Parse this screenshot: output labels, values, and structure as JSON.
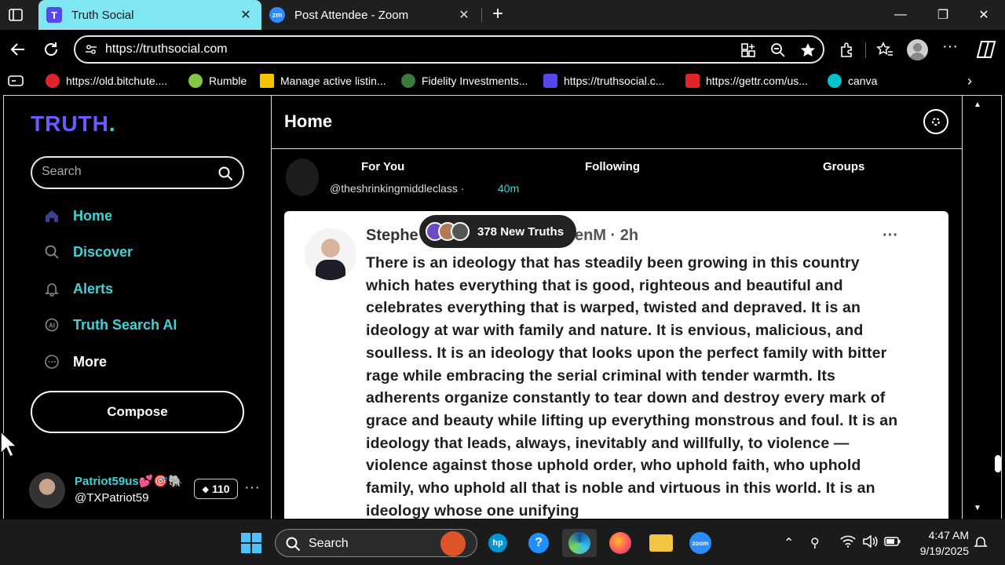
{
  "browser": {
    "tabs": [
      {
        "favicon": "T",
        "title": "Truth Social",
        "active": true
      },
      {
        "favicon": "zm",
        "title": "Post Attendee - Zoom",
        "active": false
      }
    ],
    "url": "https://truthsocial.com",
    "bookmarks": [
      {
        "label": "https://old.bitchute....",
        "icon_color": "#e0242a"
      },
      {
        "label": "Rumble",
        "icon_color": "#85c742"
      },
      {
        "label": "Manage active listin...",
        "icon_color": "#f4c400"
      },
      {
        "label": "Fidelity Investments...",
        "icon_color": "#3a7a3a"
      },
      {
        "label": "https://truthsocial.c...",
        "icon_color": "#5448ee"
      },
      {
        "label": "https://gettr.com/us...",
        "icon_color": "#e0242a"
      },
      {
        "label": "canva",
        "icon_color": "#00c4cc"
      }
    ]
  },
  "sidebar": {
    "logo": "TRUTH",
    "logo_dot": ".",
    "search_placeholder": "Search",
    "nav": [
      {
        "label": "Home",
        "icon": "home-icon"
      },
      {
        "label": "Discover",
        "icon": "search-icon"
      },
      {
        "label": "Alerts",
        "icon": "bell-icon"
      },
      {
        "label": "Truth Search AI",
        "icon": "ai-icon"
      },
      {
        "label": "More",
        "icon": "more-circle-icon"
      }
    ],
    "compose_label": "Compose",
    "profile": {
      "name": "Patriot59us💕🎯🐘",
      "handle": "@TXPatriot59",
      "badge_count": "110"
    }
  },
  "main": {
    "title": "Home",
    "tabs": [
      "For You",
      "Following",
      "Groups"
    ],
    "prev_post": {
      "handle": "@theshrinkingmiddleclass ·",
      "time": "40m"
    },
    "new_truths": "378 New Truths",
    "post": {
      "name": "Stephe",
      "handle_time": "enM · 2h",
      "text": "There is an ideology that has steadily been growing in this country which hates everything that is good, righteous and beautiful and celebrates everything that is warped, twisted and depraved. It is an ideology at war with family and nature. It is envious, malicious, and soulless. It is an ideology that looks upon the perfect family with bitter rage while embracing the serial criminal with tender warmth. Its adherents organize constantly to tear down and destroy every mark of grace and beauty while lifting up everything monstrous and foul. It is an ideology that leads, always, inevitably and willfully, to violence — violence against those uphold order, who uphold faith, who uphold family, who uphold all that is noble and virtuous in this world. It is an ideology whose one unifying"
    }
  },
  "taskbar": {
    "search_label": "Search",
    "time": "4:47 AM",
    "date": "9/19/2025"
  },
  "colors": {
    "accent_cyan": "#3fd3d6",
    "brand_purple": "#6b5cff",
    "active_tab": "#7fe6f2"
  }
}
